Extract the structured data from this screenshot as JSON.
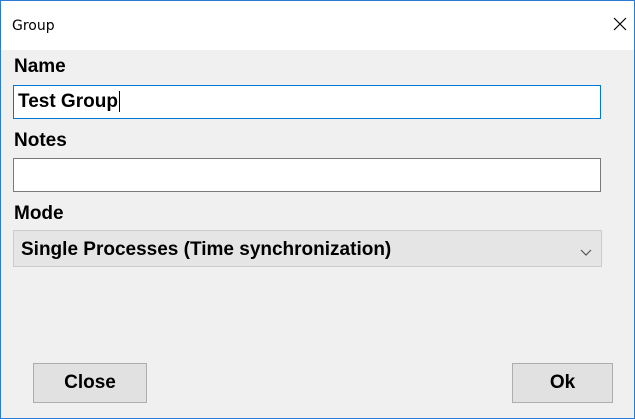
{
  "window": {
    "title": "Group",
    "close_icon": "close-icon"
  },
  "form": {
    "name_label": "Name",
    "name_value": "Test Group",
    "notes_label": "Notes",
    "notes_value": "",
    "mode_label": "Mode",
    "mode_selected": "Single Processes (Time synchronization)",
    "mode_chevron_icon": "chevron-down-icon"
  },
  "buttons": {
    "close_label": "Close",
    "ok_label": "Ok"
  },
  "colors": {
    "window_border": "#2b7bd6",
    "dialog_background": "#f0f0f0",
    "focus_border": "#0078d7",
    "button_background": "#e1e1e1"
  }
}
